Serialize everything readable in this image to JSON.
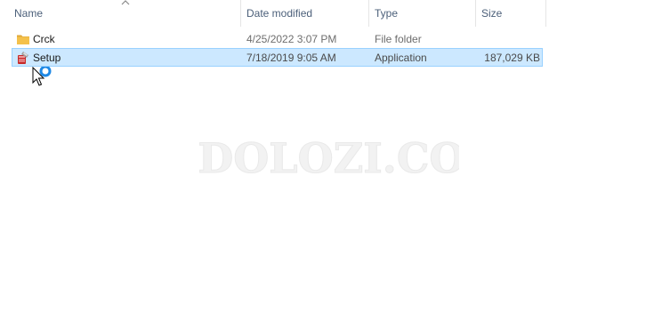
{
  "columns": {
    "name": "Name",
    "date_modified": "Date modified",
    "type": "Type",
    "size": "Size"
  },
  "files": [
    {
      "name": "Crck",
      "date_modified": "4/25/2022 3:07 PM",
      "type": "File folder",
      "size": "",
      "icon": "folder-icon",
      "selected": false
    },
    {
      "name": "Setup",
      "date_modified": "7/18/2019 9:05 AM",
      "type": "Application",
      "size": "187,029 KB",
      "icon": "installer-icon",
      "selected": true
    }
  ],
  "watermark": "ITDOLOZI.COM",
  "colors": {
    "selection_bg": "#cce8ff",
    "selection_border": "#99d1ff",
    "header_text": "#4c607a",
    "folder": "#f4c14b",
    "busy_ring": "#1e88e5"
  },
  "cursor": "busy-arrow-cursor-icon"
}
